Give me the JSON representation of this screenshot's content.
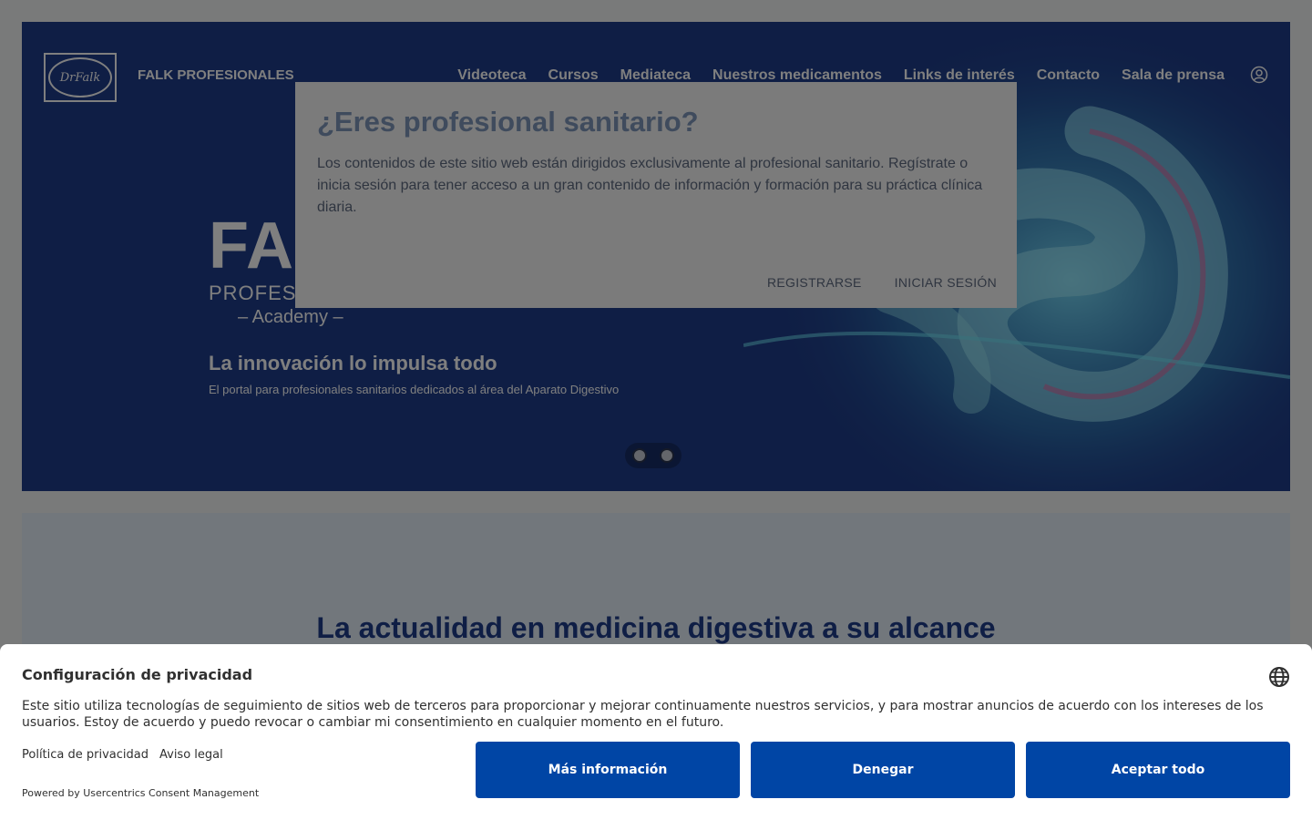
{
  "header": {
    "logo_text": "DrFalk",
    "brand": "FALK PROFESIONALES",
    "nav": [
      "Videoteca",
      "Cursos",
      "Mediateca",
      "Nuestros medicamentos",
      "Links de interés",
      "Contacto",
      "Sala de prensa"
    ],
    "user_icon": "user-circle-icon"
  },
  "hero": {
    "big": "FA",
    "prof": "PROFES",
    "academy": "– Academy –",
    "tagline": "La innovación lo impulsa todo",
    "subline": "El portal para profesionales sanitarios dedicados al área del Aparato Digestivo",
    "slides": 2
  },
  "section": {
    "title": "La actualidad en medicina digestiva a su alcance"
  },
  "modal": {
    "title": "¿Eres profesional sanitario?",
    "text": "Los contenidos de este sitio web están dirigidos exclusivamente al profesional sanitario. Regístrate o inicia sesión para tener acceso a un gran contenido de información y formación para su práctica clínica diaria.",
    "register": "REGISTRARSE",
    "login": "INICIAR SESIÓN"
  },
  "cookie": {
    "title": "Configuración de privacidad",
    "text": "Este sitio utiliza tecnologías de seguimiento de sitios web de terceros para proporcionar y mejorar continuamente nuestros servicios, y para mostrar anuncios de acuerdo con los intereses de los usuarios. Estoy de acuerdo y puedo revocar o cambiar mi consentimiento en cualquier momento en el futuro.",
    "privacy_link": "Política de privacidad",
    "legal_link": "Aviso legal",
    "powered": "Powered by Usercentrics Consent Management",
    "more": "Más información",
    "deny": "Denegar",
    "accept": "Aceptar todo",
    "globe_icon": "globe-icon"
  },
  "colors": {
    "hero_bg": "#1f3d8a",
    "button_bg": "#0045a5",
    "modal_bg": "#7b7b7b"
  }
}
